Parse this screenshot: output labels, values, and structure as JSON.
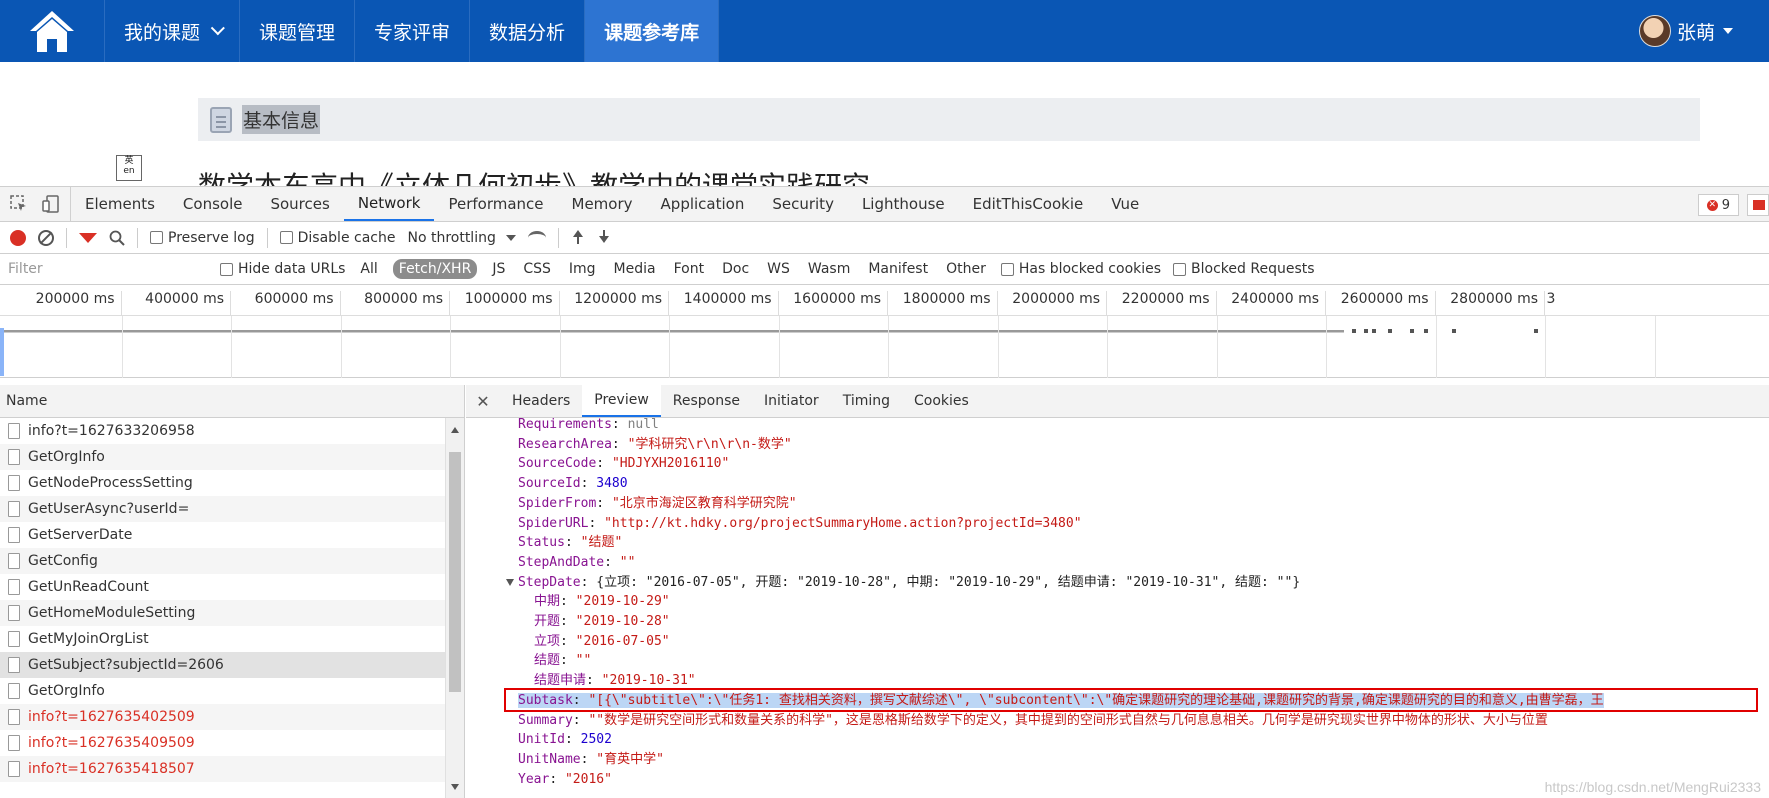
{
  "topnav": {
    "items": [
      {
        "label": "我的课题"
      },
      {
        "label": "课题管理"
      },
      {
        "label": "专家评审"
      },
      {
        "label": "数据分析"
      },
      {
        "label": "课题参考库"
      }
    ],
    "user_name": "张萌",
    "accent": "#0a56b4"
  },
  "page": {
    "section_title": "基本信息",
    "lang_icon_text": "en",
    "heading_peek": "数学本东高中《立体几何初步》教学中的课堂实践研究"
  },
  "devtools": {
    "tabs": [
      "Elements",
      "Console",
      "Sources",
      "Network",
      "Performance",
      "Memory",
      "Application",
      "Security",
      "Lighthouse",
      "EditThisCookie",
      "Vue"
    ],
    "active_tab": "Network",
    "error_count": "9",
    "toolbar": {
      "preserve_log": "Preserve log",
      "disable_cache": "Disable cache",
      "throttling": "No throttling"
    },
    "filter": {
      "placeholder": "Filter",
      "hide_data_urls": "Hide data URLs",
      "types": [
        "All",
        "Fetch/XHR",
        "JS",
        "CSS",
        "Img",
        "Media",
        "Font",
        "Doc",
        "WS",
        "Wasm",
        "Manifest",
        "Other"
      ],
      "active_type": "Fetch/XHR",
      "has_blocked_cookies": "Has blocked cookies",
      "blocked_requests": "Blocked Requests"
    },
    "timeline_ticks": [
      "200000 ms",
      "400000 ms",
      "600000 ms",
      "800000 ms",
      "1000000 ms",
      "1200000 ms",
      "1400000 ms",
      "1600000 ms",
      "1800000 ms",
      "2000000 ms",
      "2200000 ms",
      "2400000 ms",
      "2600000 ms",
      "2800000 ms",
      "3"
    ],
    "name_header": "Name",
    "requests": [
      {
        "name": "info?t=1627633206958",
        "status": "ok"
      },
      {
        "name": "GetOrgInfo",
        "status": "ok"
      },
      {
        "name": "GetNodeProcessSetting",
        "status": "ok"
      },
      {
        "name": "GetUserAsync?userId=",
        "status": "ok"
      },
      {
        "name": "GetServerDate",
        "status": "ok"
      },
      {
        "name": "GetConfig",
        "status": "ok"
      },
      {
        "name": "GetUnReadCount",
        "status": "ok"
      },
      {
        "name": "GetHomeModuleSetting",
        "status": "ok"
      },
      {
        "name": "GetMyJoinOrgList",
        "status": "ok"
      },
      {
        "name": "GetSubject?subjectId=2606",
        "status": "selected"
      },
      {
        "name": "GetOrgInfo",
        "status": "ok"
      },
      {
        "name": "info?t=1627635402509",
        "status": "error"
      },
      {
        "name": "info?t=1627635409509",
        "status": "error"
      },
      {
        "name": "info?t=1627635418507",
        "status": "error"
      }
    ],
    "detail_tabs": [
      "Headers",
      "Preview",
      "Response",
      "Initiator",
      "Timing",
      "Cookies"
    ],
    "active_detail_tab": "Preview",
    "preview_lines": [
      {
        "indent": 1,
        "key": "Requirements",
        "value": "null",
        "vtype": "null"
      },
      {
        "indent": 1,
        "key": "ResearchArea",
        "value": "\"学科研究\\r\\n\\r\\n-数学\"",
        "vtype": "str"
      },
      {
        "indent": 1,
        "key": "SourceCode",
        "value": "\"HDJYXH2016110\"",
        "vtype": "str"
      },
      {
        "indent": 1,
        "key": "SourceId",
        "value": "3480",
        "vtype": "num"
      },
      {
        "indent": 1,
        "key": "SpiderFrom",
        "value": "\"北京市海淀区教育科学研究院\"",
        "vtype": "str"
      },
      {
        "indent": 1,
        "key": "SpiderURL",
        "value": "\"http://kt.hdky.org/projectSummaryHome.action?projectId=3480\"",
        "vtype": "str"
      },
      {
        "indent": 1,
        "key": "Status",
        "value": "\"结题\"",
        "vtype": "str"
      },
      {
        "indent": 1,
        "key": "StepAndDate",
        "value": "\"\"",
        "vtype": "str"
      },
      {
        "indent": 1,
        "key": "StepDate",
        "value": "{立项: \"2016-07-05\", 开题: \"2019-10-28\", 中期: \"2019-10-29\", 结题申请: \"2019-10-31\", 结题: \"\"}",
        "vtype": "obj",
        "expanded": true
      },
      {
        "indent": 2,
        "key": "中期",
        "value": "\"2019-10-29\"",
        "vtype": "str"
      },
      {
        "indent": 2,
        "key": "开题",
        "value": "\"2019-10-28\"",
        "vtype": "str"
      },
      {
        "indent": 2,
        "key": "立项",
        "value": "\"2016-07-05\"",
        "vtype": "str"
      },
      {
        "indent": 2,
        "key": "结题",
        "value": "\"\"",
        "vtype": "str"
      },
      {
        "indent": 2,
        "key": "结题申请",
        "value": "\"2019-10-31\"",
        "vtype": "str"
      },
      {
        "indent": 1,
        "key": "Subtask",
        "value": "\"[{\\\"subtitle\\\":\\\"任务1: 查找相关资料，撰写文献综述\\\", \\\"subcontent\\\":\\\"确定课题研究的理论基础,课题研究的背景,确定课题研究的目的和意义,由曹学磊，王",
        "vtype": "str",
        "highlighted": true
      },
      {
        "indent": 1,
        "key": "Summary",
        "value": "\"\"数学是研究空间形式和数量关系的科学\"，这是恩格斯给数学下的定义，其中提到的空间形式自然与几何息息相关。几何学是研究现实世界中物体的形状、大小与位置",
        "vtype": "str"
      },
      {
        "indent": 1,
        "key": "UnitId",
        "value": "2502",
        "vtype": "num"
      },
      {
        "indent": 1,
        "key": "UnitName",
        "value": "\"育英中学\"",
        "vtype": "str"
      },
      {
        "indent": 1,
        "key": "Year",
        "value": "\"2016\"",
        "vtype": "str"
      }
    ]
  },
  "watermark": "https://blog.csdn.net/MengRui2333"
}
